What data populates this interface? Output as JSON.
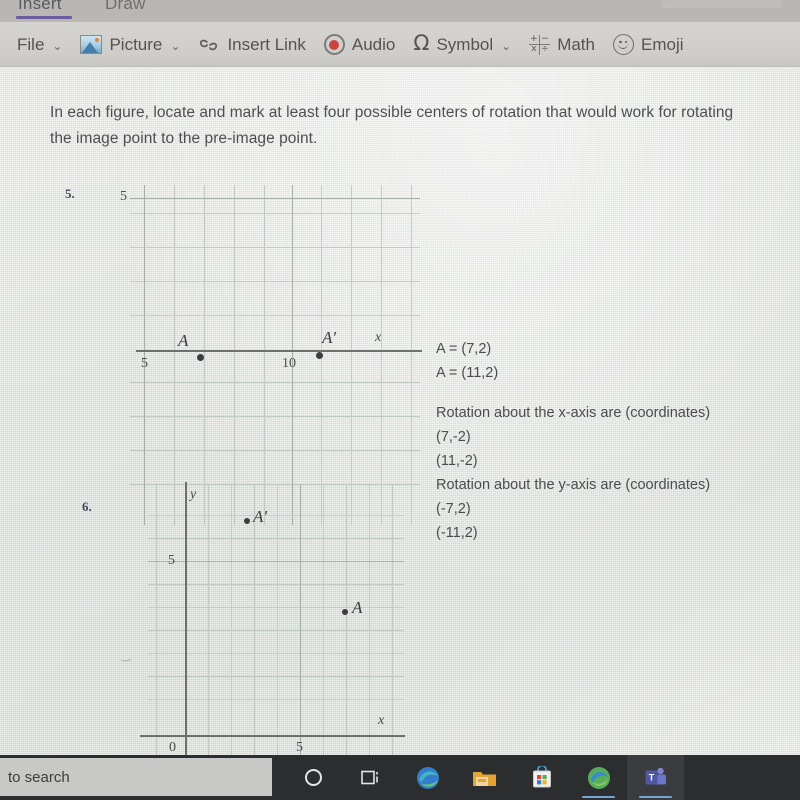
{
  "app": {
    "ribbon_tabs": [
      {
        "label": "Insert",
        "active": true
      },
      {
        "label": "Draw",
        "active": false
      }
    ],
    "toolbar": [
      {
        "label": "File",
        "icon": "none",
        "chevron": "⌄"
      },
      {
        "label": "Picture",
        "icon": "picture-icon",
        "chevron": "⌄"
      },
      {
        "label": "Insert Link",
        "icon": "link-icon",
        "chevron": ""
      },
      {
        "label": "Audio",
        "icon": "audio-record-icon",
        "chevron": ""
      },
      {
        "label": "Symbol",
        "icon": "omega-icon",
        "chevron": "⌄"
      },
      {
        "label": "Math",
        "icon": "math-operators-icon",
        "chevron": ""
      },
      {
        "label": "Emoji",
        "icon": "emoji-smiley-icon",
        "chevron": ""
      }
    ],
    "symbol_glyph": "Ω",
    "math_glyphs": {
      "plus": "+",
      "minus": "−",
      "times": "x",
      "divide": "÷"
    },
    "accent_color": "#6b5ca5",
    "record_color": "#d4403c"
  },
  "worksheet": {
    "instructions": "In each figure, locate and mark at least four possible centers of rotation that would work for rotating the image point to the pre-image point.",
    "problem5": {
      "number": "5.",
      "y_top_label": "5",
      "x_tick_labels": [
        "5",
        "10"
      ],
      "x_axis_label": "x",
      "points": [
        {
          "label": "A",
          "prime": "",
          "x_tick": "approx 7",
          "y_tick": "approx 2"
        },
        {
          "label": "A",
          "prime": "′",
          "x_tick": "approx 11",
          "y_tick": "approx 2"
        }
      ]
    },
    "problem6": {
      "number": "6.",
      "y_axis_label": "y",
      "x_axis_label": "x",
      "origin_label": "0",
      "y_tick_labels": [
        "5"
      ],
      "x_tick_labels": [
        "5"
      ],
      "points": [
        {
          "label": "A",
          "prime": "′",
          "x_tick": "approx 3",
          "y_tick": "approx 7"
        },
        {
          "label": "A",
          "prime": "",
          "x_tick": "approx 7",
          "y_tick": "approx 3"
        }
      ]
    }
  },
  "answers": {
    "line1": "A = (7,2)",
    "line2": "A = (11,2)",
    "line3": "Rotation about the x-axis are (coordinates)",
    "line4": "(7,-2)",
    "line5": "(11,-2)",
    "line6": "Rotation about the y-axis are (coordinates)",
    "line7": "(-7,2)",
    "line8": "(-11,2)"
  },
  "taskbar": {
    "search_text": "to search",
    "items": [
      {
        "name": "cortana",
        "icon": "cortana-circle-icon",
        "active": false,
        "running": false
      },
      {
        "name": "task-view",
        "icon": "task-view-icon",
        "active": false,
        "running": false
      },
      {
        "name": "edge",
        "icon": "edge-browser-icon",
        "active": false,
        "running": false
      },
      {
        "name": "file-explorer",
        "icon": "folder-icon",
        "active": false,
        "running": false
      },
      {
        "name": "microsoft-store",
        "icon": "store-bag-icon",
        "active": false,
        "running": false
      },
      {
        "name": "edge-dev",
        "icon": "edge-browser-icon",
        "active": false,
        "running": true
      },
      {
        "name": "microsoft-teams",
        "icon": "teams-icon",
        "active": true,
        "running": true
      }
    ]
  }
}
